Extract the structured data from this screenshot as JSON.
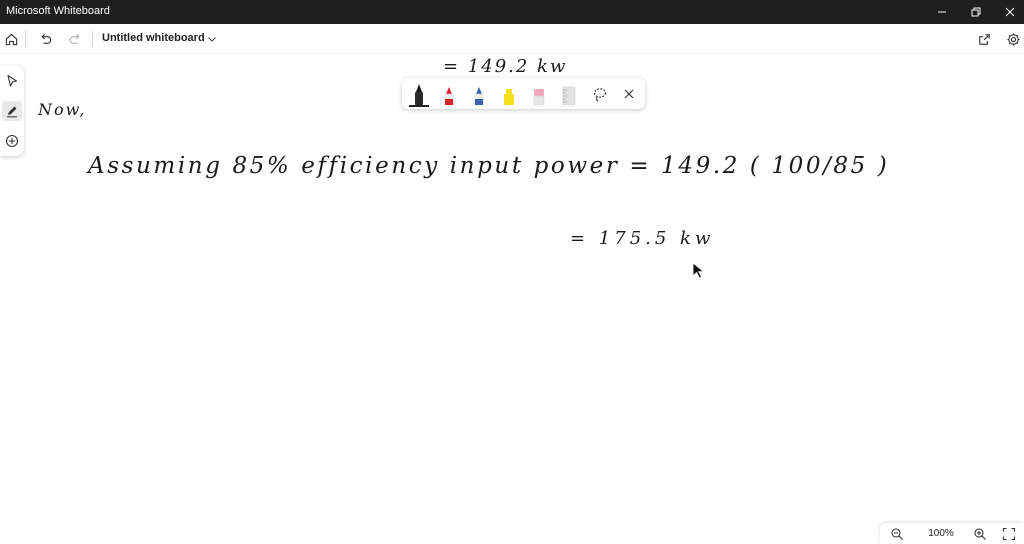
{
  "window": {
    "title": "Microsoft Whiteboard"
  },
  "appbar": {
    "board_title": "Untitled whiteboard"
  },
  "left_rail": {
    "tools": [
      "select-tool",
      "inking-tool",
      "add-tool"
    ]
  },
  "pen_toolbar": {
    "pens": [
      {
        "name": "black-pen",
        "color": "#1a1a1a",
        "selected": true
      },
      {
        "name": "red-pen",
        "color": "#e0202a",
        "selected": false
      },
      {
        "name": "blue-pen",
        "color": "#3a63b8",
        "selected": false
      },
      {
        "name": "yellow-highlighter",
        "color": "#f5e11a",
        "selected": false
      },
      {
        "name": "eraser",
        "color": "#f0a8b8",
        "selected": false
      },
      {
        "name": "ruler",
        "color": "#c8c8c8",
        "selected": false
      }
    ]
  },
  "canvas": {
    "ink_lines": [
      {
        "id": "line-prev-result",
        "text": "= 149.2 kw"
      },
      {
        "id": "line-now",
        "text": "Now,"
      },
      {
        "id": "line-assuming",
        "text": "Assuming 85% efficiency input power = 149.2 ( 100/85 )"
      },
      {
        "id": "line-result",
        "text": "= 175.5 kw"
      }
    ]
  },
  "zoom": {
    "level": "100%"
  },
  "colors": {
    "titlebar": "#1f1f1f",
    "ink": "#1a1a1a"
  }
}
